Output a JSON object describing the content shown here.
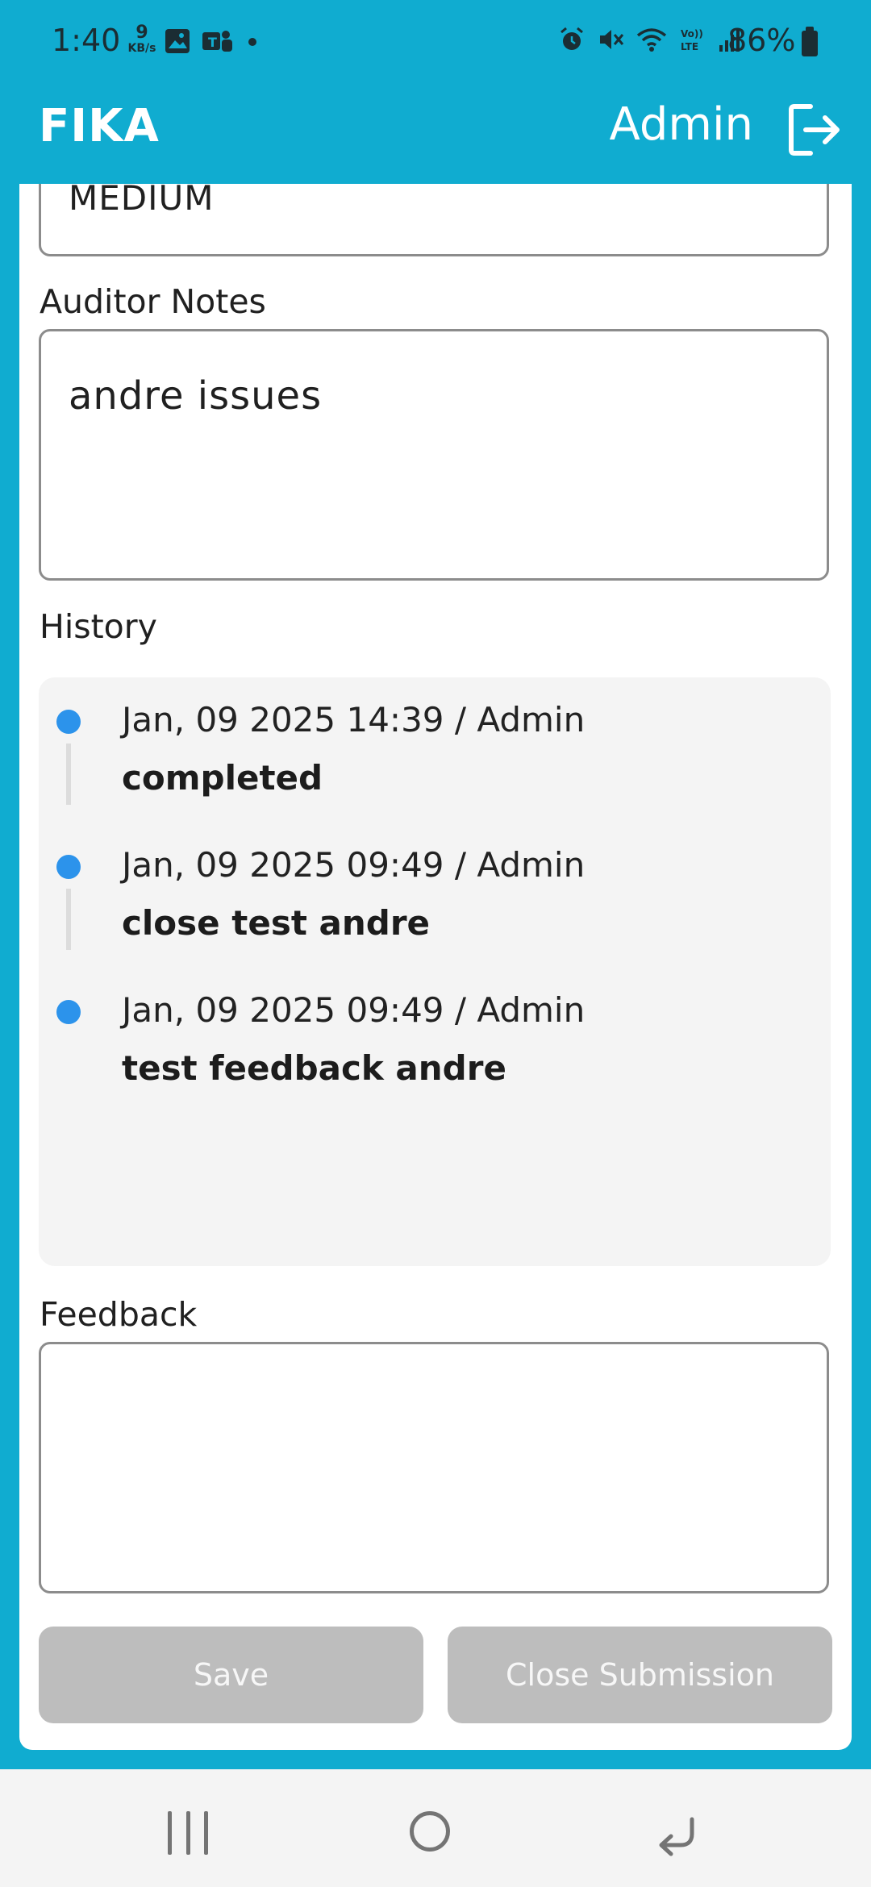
{
  "status_bar": {
    "time": "1:40",
    "data_rate_value": "9",
    "data_rate_unit": "KB/s",
    "battery": "86%",
    "icons": [
      "gallery-icon",
      "teams-icon",
      "dot-icon",
      "alarm-icon",
      "mute-icon",
      "wifi-icon",
      "volte-icon",
      "signal-icon",
      "battery-icon"
    ]
  },
  "header": {
    "app_title": "FIKA",
    "user": "Admin",
    "logout_icon": "logout-icon",
    "background": "#10acd0"
  },
  "form": {
    "priority_value": "MEDIUM",
    "auditor_notes_label": "Auditor Notes",
    "auditor_notes_value": "andre issues",
    "history_label": "History",
    "history": [
      {
        "meta": "Jan, 09 2025 14:39 / Admin",
        "status": "completed"
      },
      {
        "meta": "Jan, 09 2025 09:49 / Admin",
        "status": "close test andre"
      },
      {
        "meta": "Jan, 09 2025 09:49 / Admin",
        "status": "test feedback andre"
      }
    ],
    "feedback_label": "Feedback",
    "feedback_value": ""
  },
  "buttons": {
    "save": "Save",
    "close_submission": "Close Submission",
    "disabled_color": "#bdbdbd"
  },
  "nav_bar": {
    "icons": [
      "recents-icon",
      "home-icon",
      "back-icon"
    ]
  }
}
